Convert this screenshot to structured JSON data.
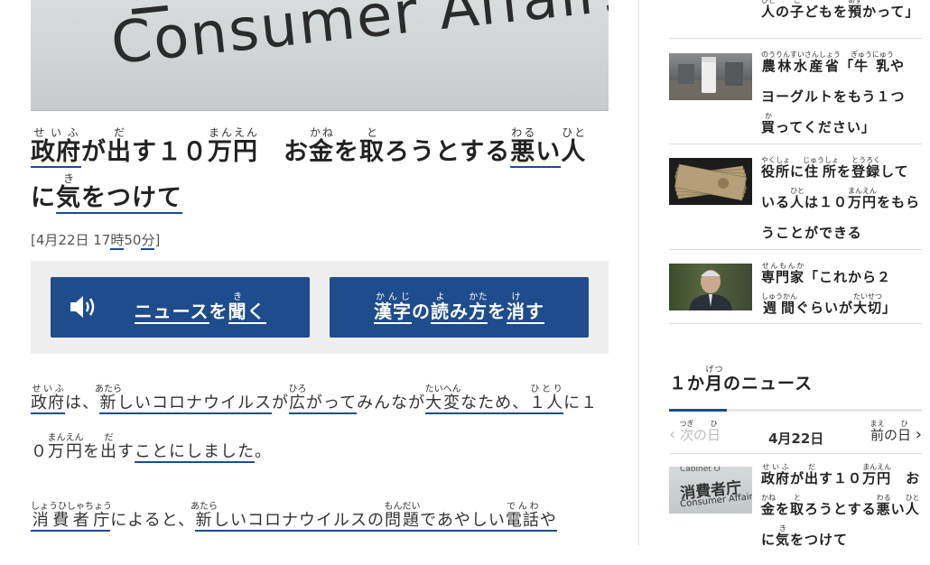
{
  "hero": {
    "photo_text": "Consumer Affairs"
  },
  "title": {
    "seg1": {
      "base": "政府",
      "ruby": "せいふ"
    },
    "seg2": "が",
    "seg3": {
      "base": "出",
      "ruby": "だ"
    },
    "seg4": "す１０",
    "seg5": {
      "base": "万円",
      "ruby": "まんえん"
    },
    "seg6": "　お",
    "seg7": {
      "base": "金",
      "ruby": "かね"
    },
    "seg8": "を",
    "seg9": {
      "base": "取",
      "ruby": "と"
    },
    "seg10": "ろうとする",
    "seg11": {
      "base": "悪",
      "ruby": "わる"
    },
    "seg12": "い",
    "seg13": {
      "base": "人",
      "ruby": "ひと"
    },
    "seg14": "に",
    "seg15": {
      "base": "気",
      "ruby": "き"
    },
    "seg16": "をつけて"
  },
  "date": {
    "prefix": "[4月22日 17",
    "hour_unit": "時",
    "minutes": "50",
    "minute_unit": "分",
    "suffix": "]"
  },
  "buttons": {
    "listen": {
      "pre": "ニュース",
      "mid": "を",
      "kanji": "聞",
      "ruby": "き",
      "post": "く"
    },
    "reading": {
      "kanji1": "漢字",
      "ruby1": "かんじ",
      "no": "の",
      "kanji2": "読",
      "ruby2": "よ",
      "mi": "み",
      "kanji3": "方",
      "ruby3": "かた",
      "wo": "を",
      "kanji4": "消",
      "ruby4": "け",
      "su": "す"
    }
  },
  "body": {
    "p1": {
      "a": "政府",
      "a_r": "せいふ",
      "b": "は、",
      "c": "新",
      "c_r": "あたら",
      "d": "しい",
      "e": "コロナウイルス",
      "f": "が",
      "g": "広",
      "g_r": "ひろ",
      "h": "がって",
      "i": "みんなが",
      "j": "大変",
      "j_r": "たいへん",
      "k": "なため、",
      "l": "１人",
      "l_r": "ひとり",
      "m": "に",
      "n": "１０",
      "o": "万円",
      "o_r": "まんえん",
      "p": "を",
      "q": "出",
      "q_r": "だ",
      "r": "す",
      "s": "ことにしました",
      "t": "。"
    },
    "p2": {
      "a": "消費者庁",
      "a_r": "しょうひしゃちょう",
      "b": "によると、",
      "c": "新",
      "c_r": "あたら",
      "d": "しい",
      "e": "コロナウイルス",
      "f": "の",
      "g": "問題",
      "g_r": "もんだい",
      "h": "で",
      "i": "あやしい",
      "j": "電話",
      "j_r": "でんわ",
      "k": "や"
    }
  },
  "side": {
    "top_item": {
      "a": "人",
      "a_r": "ひと",
      "b": "の",
      "c": "子",
      "c_r": "こ",
      "d": "どもを",
      "e": "預",
      "e_r": "あず",
      "f": "かって」"
    },
    "milk": {
      "a": "農林水産省",
      "a_r": "のうりんすいさんしょう",
      "b": "「",
      "c": "牛乳",
      "c_r": "ぎゅうにゅう",
      "d": "や",
      "e": "ヨーグルトをもう１つ",
      "f": "買",
      "f_r": "か",
      "g": "ってください」"
    },
    "money": {
      "a": "役所",
      "a_r": "やくしょ",
      "b": "に",
      "c": "住所",
      "c_r": "じゅうしょ",
      "d": "を",
      "e": "登録",
      "e_r": "とうろく",
      "f": "して",
      "g": "いる",
      "h": "人",
      "h_r": "ひと",
      "i": "は１０",
      "j": "万円",
      "j_r": "まんえん",
      "k": "をもら",
      "l": "うことができる"
    },
    "expert": {
      "a": "専門家",
      "a_r": "せんもんか",
      "b": "「これから２",
      "c": "週間",
      "c_r": "しゅうかん",
      "d": "ぐらいが",
      "e": "大切",
      "e_r": "たいせつ",
      "f": "」"
    },
    "month_heading": {
      "pre": "１か",
      "kanji": "月",
      "ruby": "げつ",
      "post": "のニュース"
    },
    "date_nav": {
      "prev": "次",
      "prev_r": "つぎ",
      "prev_no": "の",
      "prev_day": "日",
      "prev_day_r": "ひ",
      "current": "4月22日",
      "next": "前",
      "next_r": "まえ",
      "next_no": "の",
      "next_day": "日",
      "next_day_r": "ひ"
    },
    "caa": {
      "thumb_text_1": "消費者庁",
      "thumb_text_2": "Consumer Affairs",
      "thumb_text_0": "Cabinet O",
      "a": "政府",
      "a_r": "せいふ",
      "b": "が",
      "c": "出",
      "c_r": "だ",
      "d": "す１０",
      "e": "万円",
      "e_r": "まんえん",
      "f": "　お",
      "g": "金",
      "g_r": "かね",
      "h": "を",
      "i": "取",
      "i_r": "と",
      "j": "ろうとする",
      "k": "悪",
      "k_r": "わる",
      "l": "い",
      "m": "人",
      "m_r": "ひと",
      "n": "に",
      "o": "気",
      "o_r": "き",
      "p": "をつけて"
    }
  },
  "colors": {
    "accent": "#1e4c8c",
    "panel": "#eeeeee"
  },
  "icons": {
    "listen_icon": "speaker-icon",
    "prev_icon": "chevron-left-icon",
    "next_icon": "chevron-right-icon"
  }
}
